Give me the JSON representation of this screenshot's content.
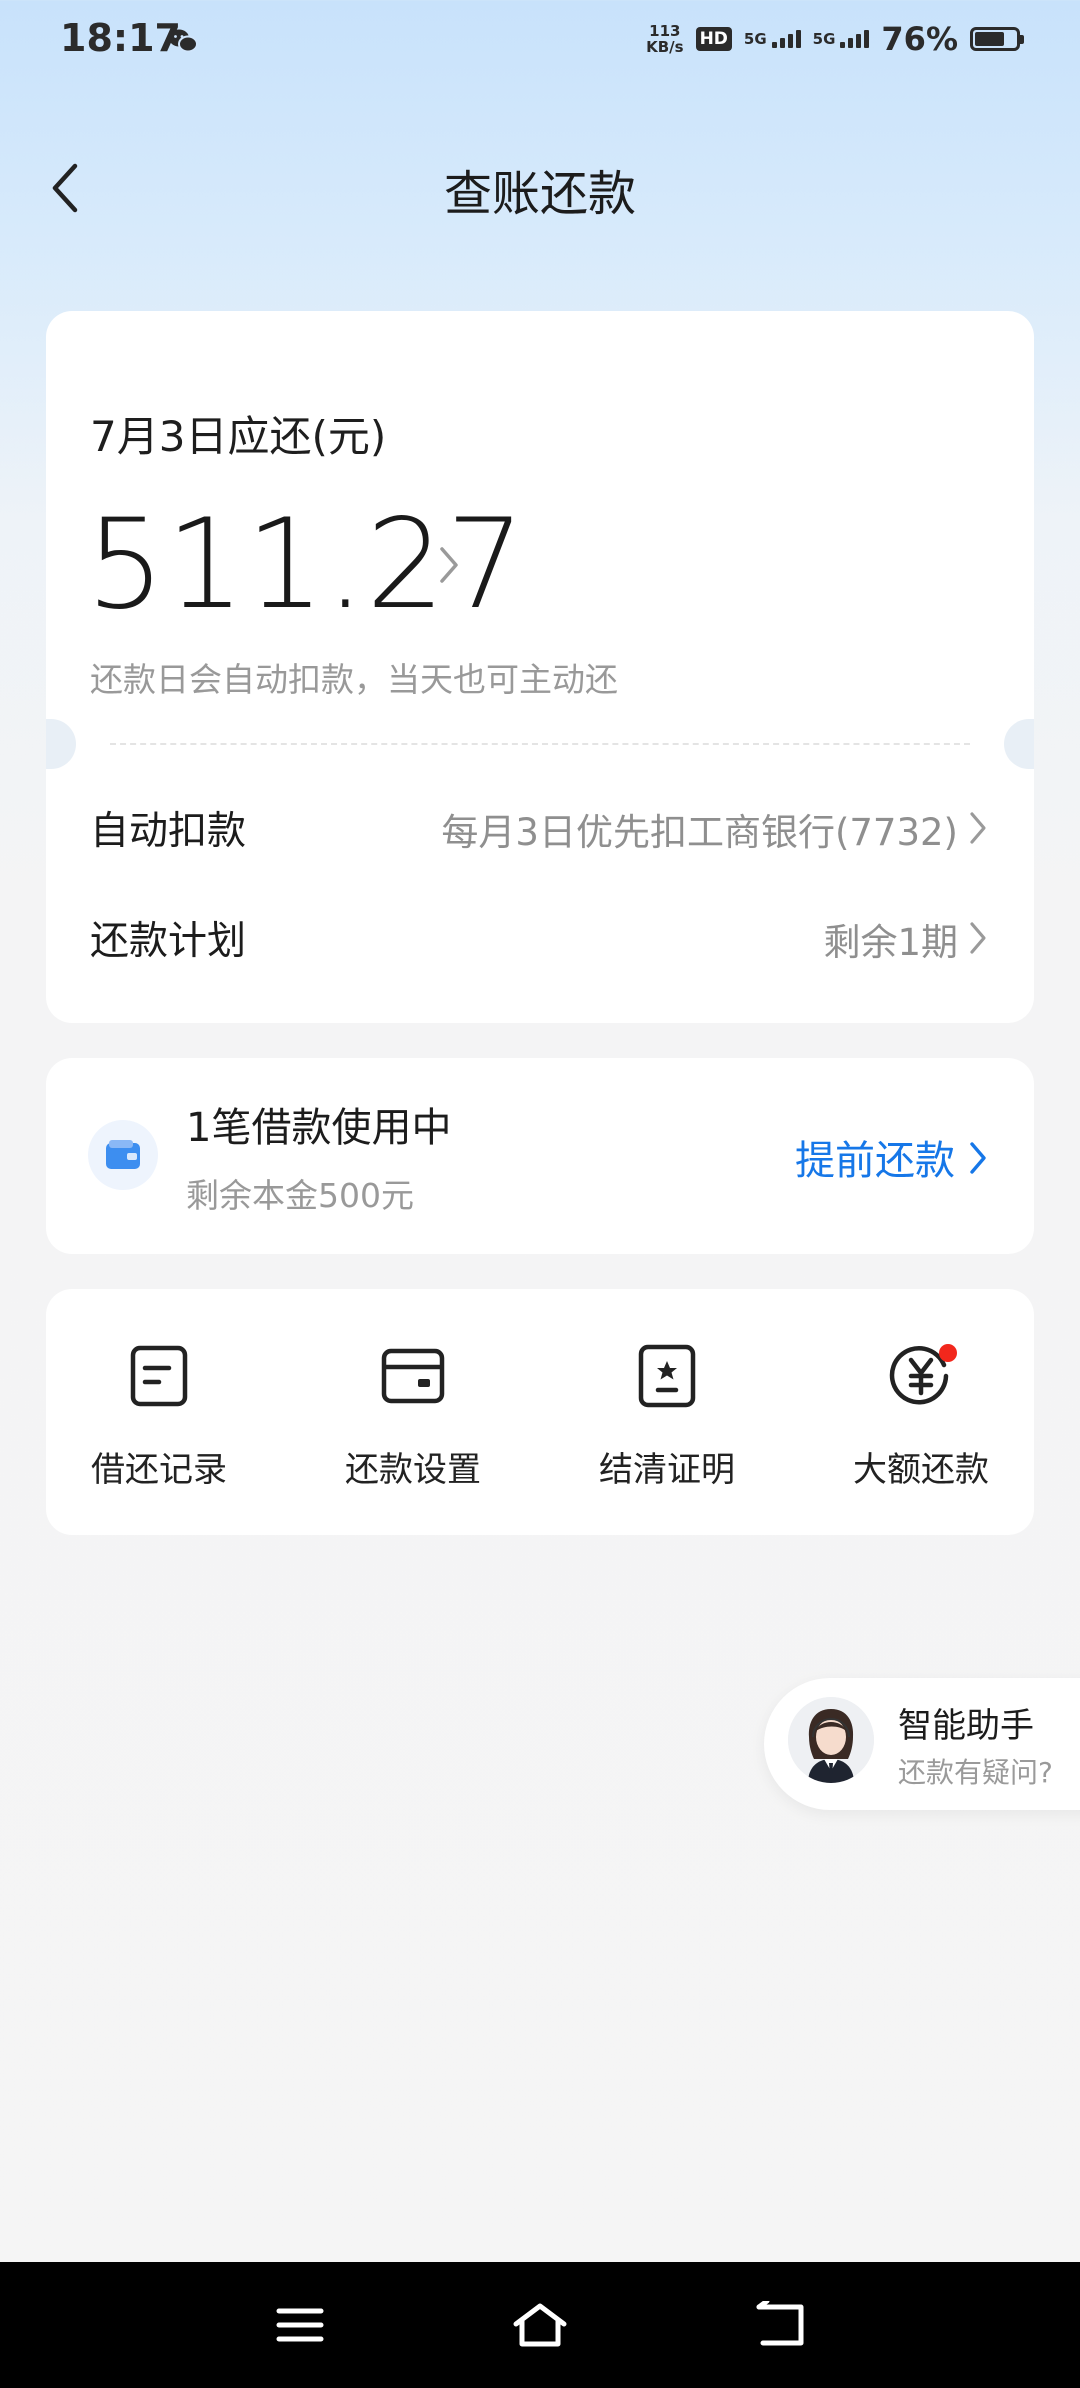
{
  "status_bar": {
    "time": "18:17",
    "net_speed_value": "113",
    "net_speed_unit": "KB/s",
    "hd_label": "HD",
    "sim1_label": "5G",
    "sim2_label": "5G",
    "battery_text": "76%",
    "battery_level": 0.76
  },
  "header": {
    "title": "查账还款"
  },
  "bill": {
    "due_label": "7月3日应还(元)",
    "amount": "511.27",
    "auto_note": "还款日会自动扣款，当天也可主动还",
    "auto_debit_label": "自动扣款",
    "auto_debit_value": "每月3日优先扣工商银行(7732)",
    "plan_label": "还款计划",
    "plan_value": "剩余1期"
  },
  "loan": {
    "title": "1笔借款使用中",
    "subtitle": "剩余本金500元",
    "action": "提前还款"
  },
  "shortcuts": [
    {
      "label": "借还记录",
      "icon": "document-icon"
    },
    {
      "label": "还款设置",
      "icon": "card-icon"
    },
    {
      "label": "结清证明",
      "icon": "certificate-icon"
    },
    {
      "label": "大额还款",
      "icon": "yuan-icon"
    }
  ],
  "assistant": {
    "title": "智能助手",
    "subtitle": "还款有疑问?"
  },
  "colors": {
    "accent": "#1677e8",
    "badge_red": "#f2271c"
  }
}
